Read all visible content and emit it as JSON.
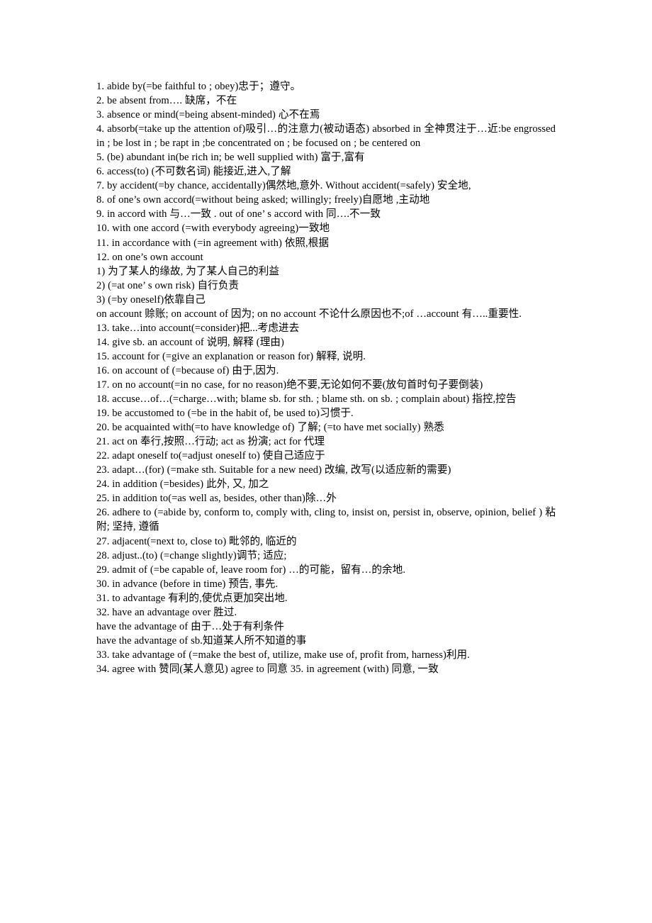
{
  "document": {
    "page_background": "#ffffff",
    "text_color": "#000000",
    "lines": [
      {
        "id": "item-1",
        "text": "1. abide by(=be faithful to ; obey)忠于；遵守。",
        "wraps": false
      },
      {
        "id": "item-2",
        "text": "2. be absent from…. 缺席，不在",
        "wraps": false
      },
      {
        "id": "item-3",
        "text": "3. absence or mind(=being absent-minded) 心不在焉",
        "wraps": false
      },
      {
        "id": "item-4",
        "text": "4. absorb(=take up the attention of)吸引…的注意力(被动语态) absorbed in 全神贯注于…近:be engrossed in ; be lost in ; be rapt in ;be concentrated on ; be focused on ; be centered on",
        "wraps": true
      },
      {
        "id": "item-5",
        "text": "5. (be) abundant in(be rich in; be well supplied with) 富于,富有",
        "wraps": false
      },
      {
        "id": "item-6",
        "text": "6. access(to) (不可数名词) 能接近,进入,了解",
        "wraps": false
      },
      {
        "id": "item-7",
        "text": "7. by accident(=by chance, accidentally)偶然地,意外. Without accident(=safely) 安全地,",
        "wraps": false
      },
      {
        "id": "item-8",
        "text": "8. of one’s own accord(=without being asked; willingly; freely)自愿地 ,主动地",
        "wraps": false
      },
      {
        "id": "item-9",
        "text": "9. in accord with 与…一致 . out of one’ s accord with 同….不一致",
        "wraps": false
      },
      {
        "id": "item-10",
        "text": "10. with one accord (=with everybody agreeing)一致地",
        "wraps": false
      },
      {
        "id": "item-11",
        "text": "11. in accordance with (=in agreement with) 依照,根据",
        "wraps": false
      },
      {
        "id": "item-12",
        "text": "12. on one’s own account",
        "wraps": false
      },
      {
        "id": "item-12-1",
        "text": "1) 为了某人的缘故, 为了某人自己的利益",
        "wraps": false
      },
      {
        "id": "item-12-2",
        "text": "2) (=at one’ s own risk) 自行负责",
        "wraps": false
      },
      {
        "id": "item-12-3",
        "text": "3) (=by oneself)依靠自己",
        "wraps": false
      },
      {
        "id": "on-account-note",
        "text": "on account 赊账; on account of 因为; on no account 不论什么原因也不;of …account 有…..重要性.",
        "wraps": true
      },
      {
        "id": "item-13",
        "text": "13. take…into account(=consider)把...考虑进去",
        "wraps": false
      },
      {
        "id": "item-14",
        "text": "14. give sb. an account of 说明, 解释 (理由)",
        "wraps": false
      },
      {
        "id": "item-15",
        "text": "15. account for (=give an explanation or reason for) 解释, 说明.",
        "wraps": false
      },
      {
        "id": "item-16",
        "text": "16. on account of (=because of) 由于,因为.",
        "wraps": false
      },
      {
        "id": "item-17",
        "text": "17. on no account(=in no case, for no reason)绝不要,无论如何不要(放句首时句子要倒装)",
        "wraps": false
      },
      {
        "id": "item-18",
        "text": "18. accuse…of…(=charge…with; blame sb. for sth. ; blame sth. on sb. ; complain about) 指控,控告",
        "wraps": true
      },
      {
        "id": "item-19",
        "text": "19. be accustomed to (=be in the habit of, be used to)习惯于.",
        "wraps": false
      },
      {
        "id": "item-20",
        "text": "20. be acquainted with(=to have knowledge of) 了解; (=to have met socially) 熟悉",
        "wraps": false
      },
      {
        "id": "item-21",
        "text": "21. act on 奉行,按照…行动; act as 扮演; act for 代理",
        "wraps": false
      },
      {
        "id": "item-22",
        "text": "22. adapt oneself to(=adjust oneself to) 使自己适应于",
        "wraps": false
      },
      {
        "id": "item-23",
        "text": "23. adapt…(for) (=make sth. Suitable for a new need) 改编, 改写(以适应新的需要)",
        "wraps": false
      },
      {
        "id": "item-24",
        "text": "24. in addition (=besides) 此外, 又, 加之",
        "wraps": false
      },
      {
        "id": "item-25",
        "text": "25. in addition to(=as well as, besides, other than)除…外",
        "wraps": false
      },
      {
        "id": "item-26",
        "text": "26. adhere to (=abide by, conform to, comply with, cling to, insist on, persist in, observe, opinion, belief ) 粘附; 坚持, 遵循",
        "wraps": true
      },
      {
        "id": "item-27",
        "text": "27. adjacent(=next to, close to) 毗邻的, 临近的",
        "wraps": false
      },
      {
        "id": "item-28",
        "text": "28. adjust..(to) (=change slightly)调节; 适应;",
        "wraps": false
      },
      {
        "id": "item-29",
        "text": "29. admit of (=be capable of, leave room for) …的可能，留有…的余地.",
        "wraps": false
      },
      {
        "id": "item-30",
        "text": "30. in advance (before in time) 预告, 事先.",
        "wraps": false
      },
      {
        "id": "item-31",
        "text": "31. to advantage 有利的,使优点更加突出地.",
        "wraps": false
      },
      {
        "id": "item-32",
        "text": "32. have an advantage over 胜过.",
        "wraps": false
      },
      {
        "id": "item-32-1",
        "text": "have the advantage of 由于…处于有利条件",
        "wraps": false
      },
      {
        "id": "item-32-2",
        "text": "have the advantage of sb.知道某人所不知道的事",
        "wraps": false
      },
      {
        "id": "item-33",
        "text": "33. take advantage of (=make the best of, utilize, make use of, profit from, harness)利用.",
        "wraps": false
      },
      {
        "id": "item-34",
        "text": "34. agree with 赞同(某人意见) agree to 同意 35. in agreement (with) 同意, 一致",
        "wraps": false
      }
    ]
  }
}
